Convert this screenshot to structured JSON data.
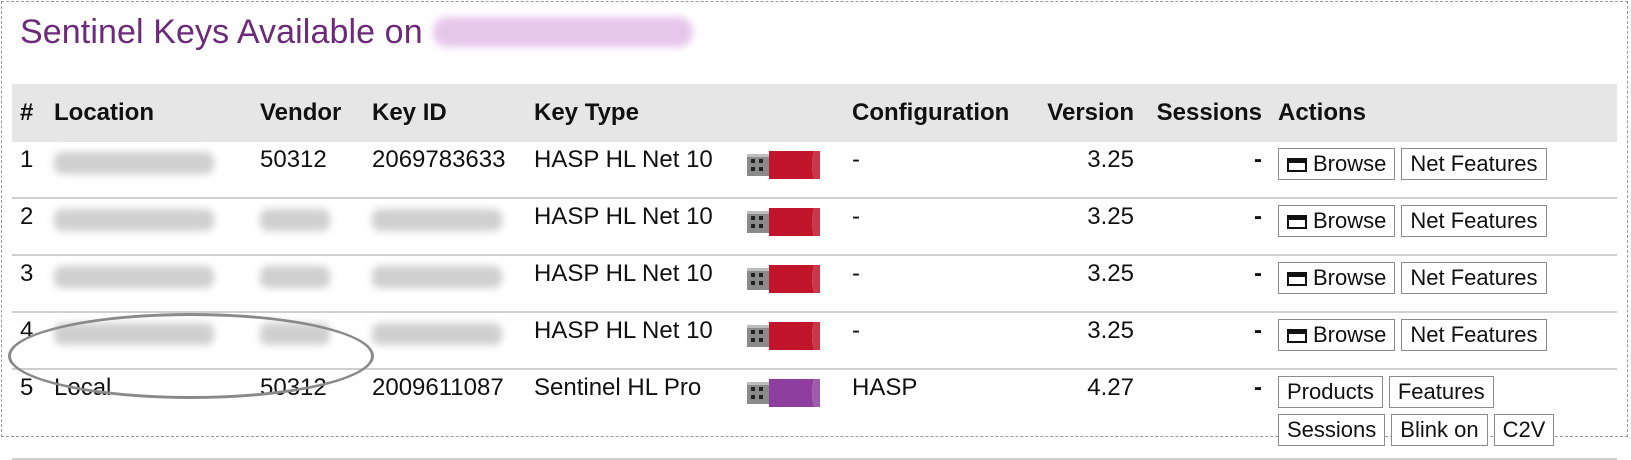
{
  "page": {
    "title": "Sentinel Keys Available on"
  },
  "table": {
    "headers": [
      "#",
      "Location",
      "Vendor",
      "Key ID",
      "Key Type",
      "",
      "Configuration",
      "Version",
      "Sessions",
      "Actions"
    ],
    "rows": [
      {
        "num": "1",
        "location": "",
        "vendor": "50312",
        "key_id": "2069783633",
        "key_type": "HASP HL Net 10",
        "key_color": "#c0152a",
        "configuration": "-",
        "version": "3.25",
        "sessions": "-",
        "actions": [
          "Browse",
          "Net Features"
        ]
      },
      {
        "num": "2",
        "location": "",
        "vendor": "",
        "key_id": "",
        "key_type": "HASP HL Net 10",
        "key_color": "#c0152a",
        "configuration": "-",
        "version": "3.25",
        "sessions": "-",
        "actions": [
          "Browse",
          "Net Features"
        ]
      },
      {
        "num": "3",
        "location": "",
        "vendor": "",
        "key_id": "",
        "key_type": "HASP HL Net 10",
        "key_color": "#c0152a",
        "configuration": "-",
        "version": "3.25",
        "sessions": "-",
        "actions": [
          "Browse",
          "Net Features"
        ]
      },
      {
        "num": "4",
        "location": "",
        "vendor": "",
        "key_id": "",
        "key_type": "HASP HL Net 10",
        "key_color": "#c0152a",
        "configuration": "-",
        "version": "3.25",
        "sessions": "-",
        "actions": [
          "Browse",
          "Net Features"
        ]
      },
      {
        "num": "5",
        "location": "Local",
        "vendor": "50312",
        "key_id": "2009611087",
        "key_type": "Sentinel HL Pro",
        "key_color": "#8e3e9e",
        "configuration": "HASP",
        "version": "4.27",
        "sessions": "-",
        "actions": [
          "Products",
          "Features",
          "Sessions",
          "Blink on",
          "C2V"
        ]
      }
    ]
  },
  "colors": {
    "title": "#6d2a7b",
    "header_bg": "#e6e6e6",
    "net_key": "#c0152a",
    "pro_key": "#8e3e9e"
  }
}
